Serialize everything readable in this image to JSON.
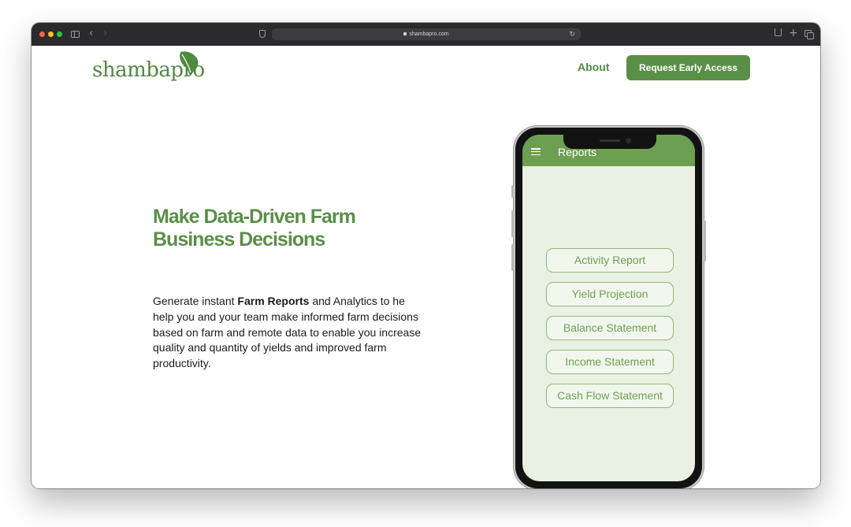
{
  "browser": {
    "url": "shambapro.com"
  },
  "site": {
    "logo_text": "shambapro",
    "nav": {
      "about": "About",
      "cta": "Request Early Access"
    }
  },
  "hero": {
    "headline": "Make Data-Driven Farm Business Decisions",
    "body_before": "Generate instant ",
    "body_bold": "Farm Reports",
    "body_after": " and Analytics to he help you and your team make informed farm decisions based  on farm and remote data to enable you increase quality and quantity of yields and improved farm productivity."
  },
  "phone_app": {
    "title": "Reports",
    "buttons": [
      "Activity Report",
      "Yield Projection",
      "Balance Statement",
      "Income Statement",
      "Cash Flow Statement"
    ]
  },
  "colors": {
    "brand_green": "#5a8f48",
    "app_header_green": "#6d9f53",
    "titlebar": "#2b2b2d"
  }
}
